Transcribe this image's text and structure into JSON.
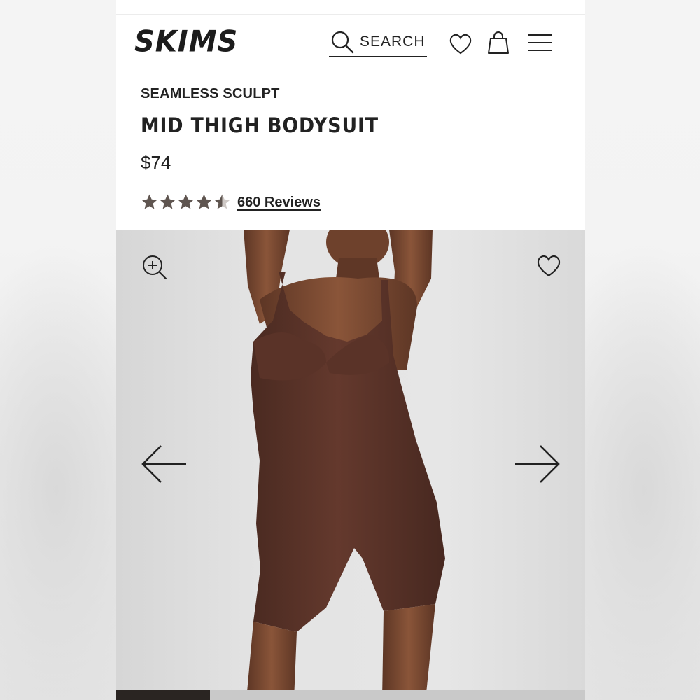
{
  "header": {
    "logo": "SKIMS",
    "search_label": "SEARCH",
    "icons": [
      "search-icon",
      "heart-icon",
      "shopping-bag-icon",
      "menu-icon"
    ]
  },
  "product": {
    "collection": "SEAMLESS SCULPT",
    "name": "MID THIGH BODYSUIT",
    "price": "$74",
    "rating": 4.5,
    "rating_max": 5,
    "reviews_label": "660 Reviews"
  },
  "gallery": {
    "icons": [
      "zoom-in-icon",
      "heart-icon",
      "arrow-left-icon",
      "arrow-right-icon"
    ],
    "progress": 0.2
  },
  "colors": {
    "text": "#222222",
    "star": "#5f5550",
    "garment": "#5a372d",
    "skin": "#7a4a33",
    "progress": "#2a2522"
  }
}
